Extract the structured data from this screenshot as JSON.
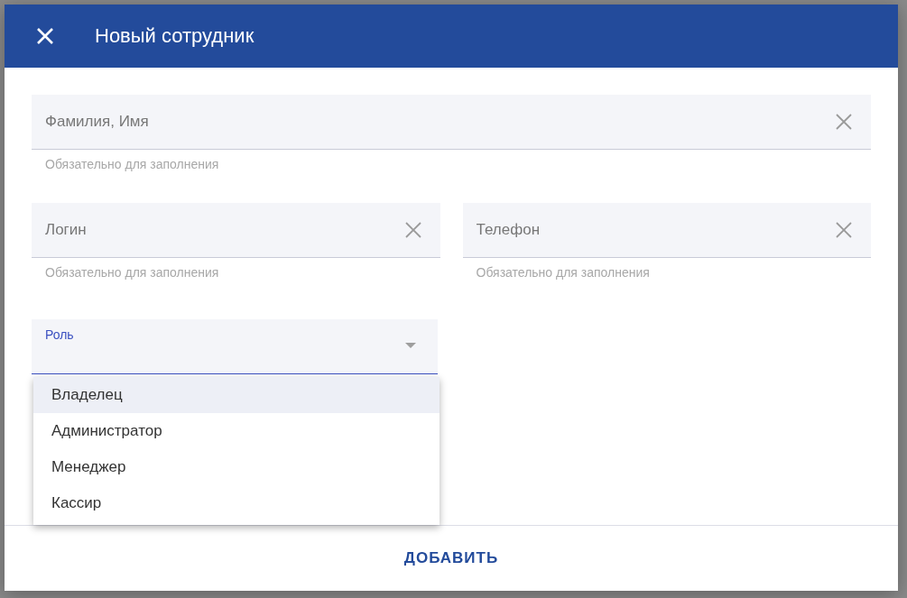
{
  "dialog": {
    "title": "Новый сотрудник",
    "fields": [
      {
        "placeholder": "Фамилия, Имя",
        "hint": "Обязательно для заполнения"
      },
      {
        "placeholder": "Логин",
        "hint": "Обязательно для заполнения"
      },
      {
        "placeholder": "Телефон",
        "hint": "Обязательно для заполнения"
      }
    ],
    "role": {
      "label": "Роль",
      "expanded": true,
      "options": [
        {
          "label": "Владелец",
          "selected": true
        },
        {
          "label": "Администратор",
          "selected": false
        },
        {
          "label": "Менеджер",
          "selected": false
        },
        {
          "label": "Кассир",
          "selected": false
        }
      ]
    },
    "submit": "ДОБАВИТЬ"
  }
}
